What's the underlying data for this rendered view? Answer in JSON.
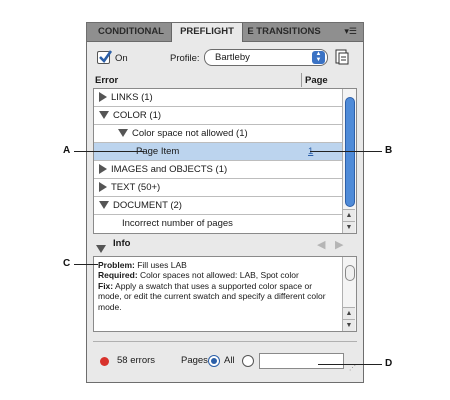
{
  "tabs": [
    "CONDITIONAL",
    "PREFLIGHT",
    "E TRANSITIONS"
  ],
  "menu_icon": "panel-menu-icon",
  "header": {
    "on_label": "On",
    "profile_label": "Profile:",
    "profile_value": "Bartleby"
  },
  "columns": {
    "error": "Error",
    "page": "Page"
  },
  "rows": [
    {
      "label": "LINKS (1)",
      "expanded": false
    },
    {
      "label": "COLOR (1)",
      "expanded": true
    },
    {
      "label": "Color space not allowed (1)",
      "expanded": true
    },
    {
      "label": "Page Item",
      "page": "1",
      "selected": true
    },
    {
      "label": "IMAGES and OBJECTS (1)",
      "expanded": false
    },
    {
      "label": "TEXT (50+)",
      "expanded": false
    },
    {
      "label": "DOCUMENT (2)",
      "expanded": true
    },
    {
      "label": "Incorrect number of pages"
    }
  ],
  "info": {
    "label": "Info",
    "problem_label": "Problem:",
    "problem": "Fill uses LAB",
    "required_label": "Required:",
    "required": "Color spaces not allowed: LAB, Spot color",
    "fix_label": "Fix:",
    "fix": "Apply a swatch that uses a supported color space or mode, or edit the current swatch and specify a different color mode."
  },
  "footer": {
    "errors": "58 errors",
    "pages_label": "Pages:",
    "all_label": "All",
    "status_color": "#d8322c"
  },
  "callouts": {
    "a": "A",
    "b": "B",
    "c": "C",
    "d": "D"
  }
}
